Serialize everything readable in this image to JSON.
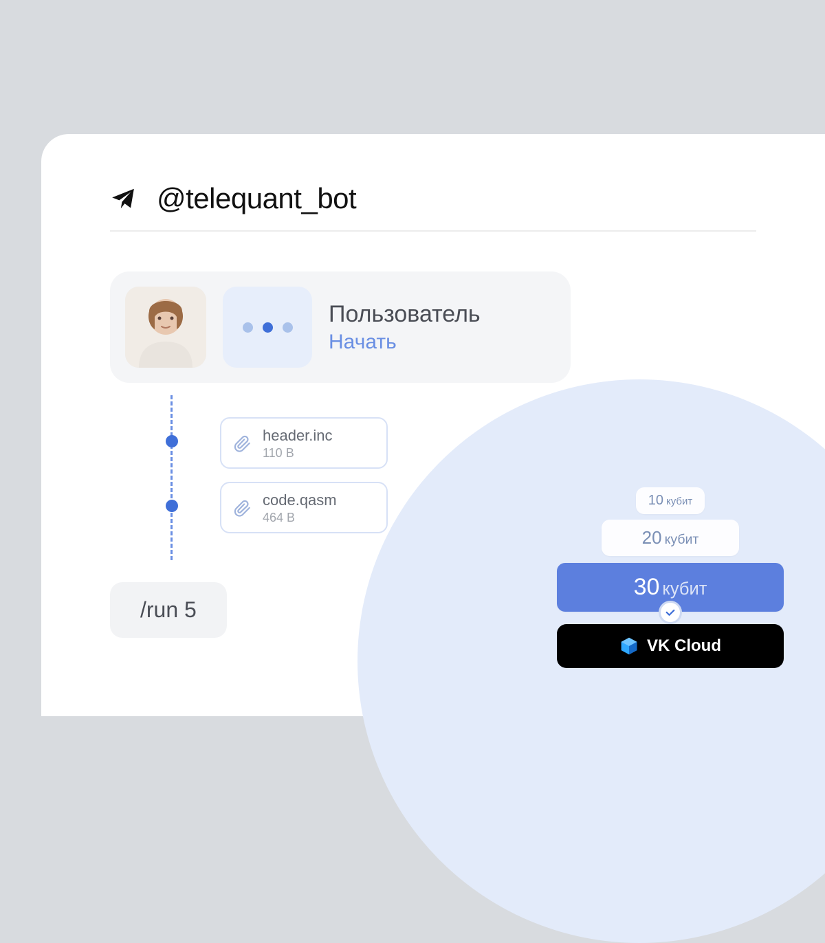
{
  "header": {
    "bot_handle": "@telequant_bot"
  },
  "user_card": {
    "name": "Пользователь",
    "action": "Начать"
  },
  "attachments": [
    {
      "filename": "header.inc",
      "size": "110 B"
    },
    {
      "filename": "code.qasm",
      "size": "464 B"
    }
  ],
  "command": "/run 5",
  "options": [
    {
      "num": "10",
      "unit": "кубит"
    },
    {
      "num": "20",
      "unit": "кубит"
    },
    {
      "num": "30",
      "unit": "кубит"
    }
  ],
  "provider": {
    "label": "VK Cloud"
  }
}
